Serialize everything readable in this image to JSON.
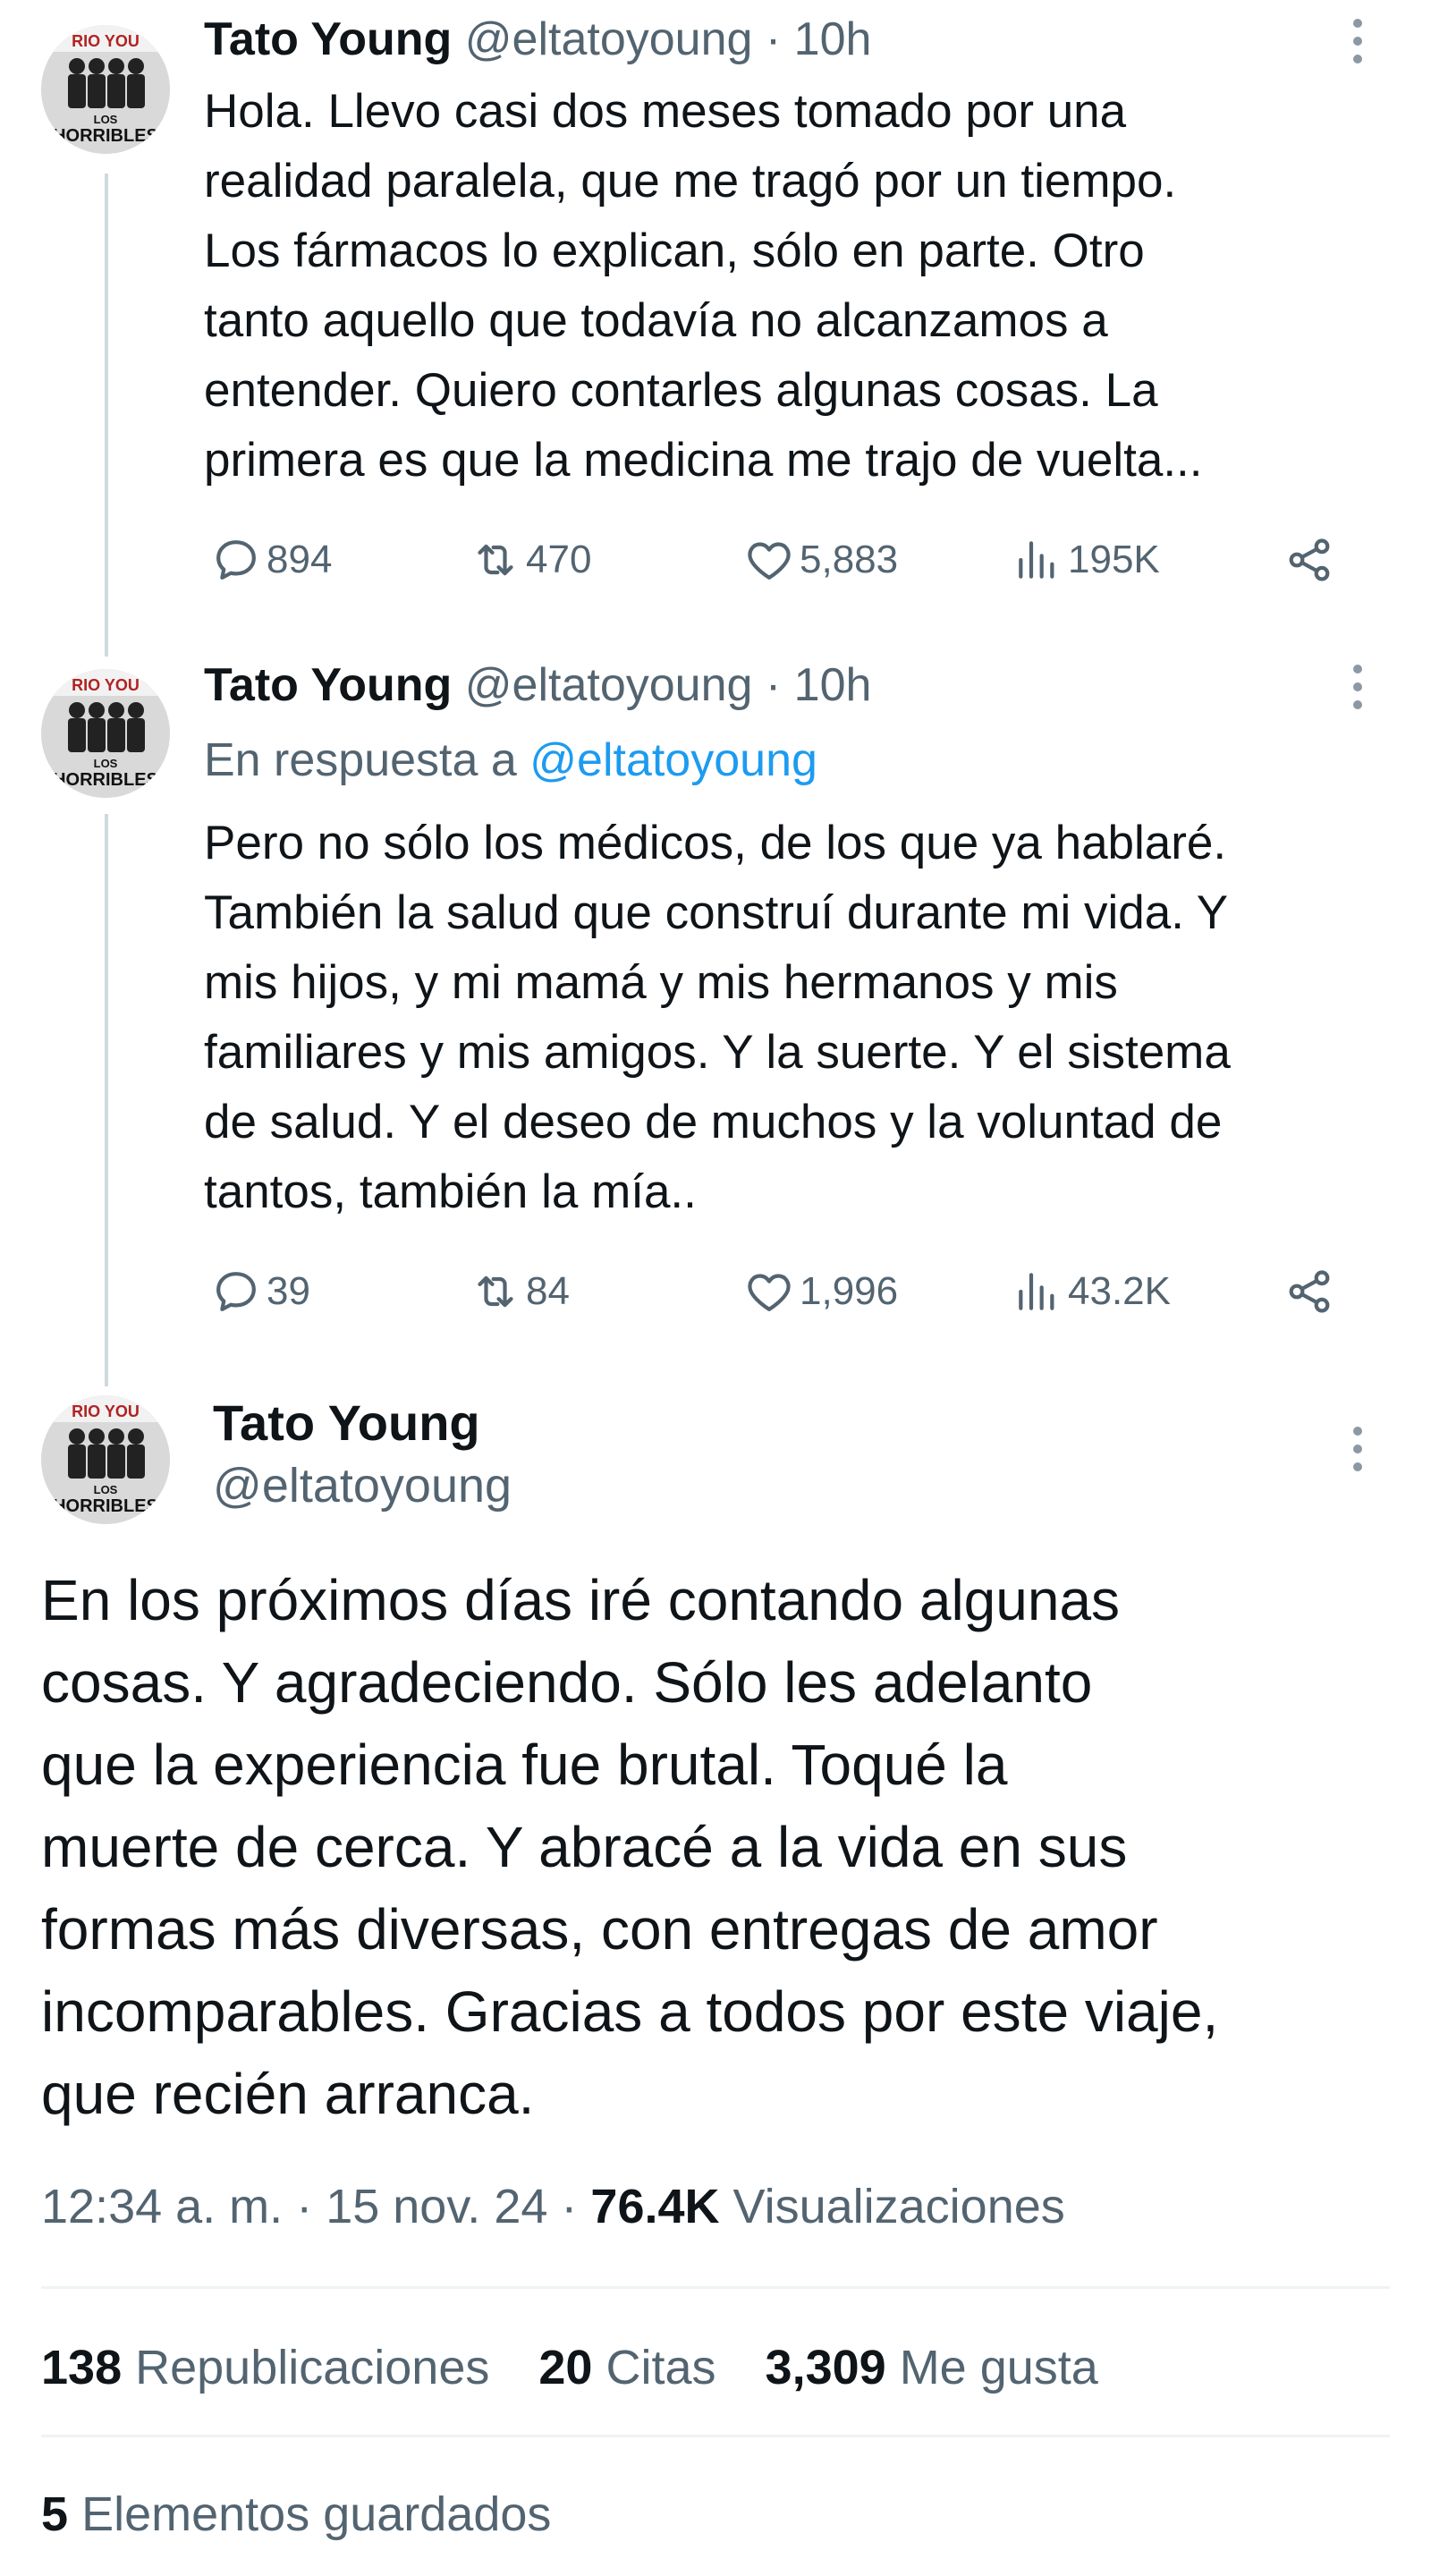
{
  "colors": {
    "text": "#0f1419",
    "secondary": "#536471",
    "link": "#1d9bf0",
    "thread_line": "#cfd9de"
  },
  "avatar": {
    "brand_text_top": "RIO YOU",
    "brand_text_small": "LOS",
    "brand_text_bottom": "HORRIBLES"
  },
  "tweets": [
    {
      "name": "Tato Young",
      "handle": "@eltatoyoung",
      "separator": " · ",
      "time": "10h",
      "text": "Hola. Llevo casi dos meses tomado por una\nrealidad paralela, que me tragó por un tiempo.\nLos fármacos lo explican, sólo en parte. Otro\ntanto aquello que todavía no alcanzamos a\nentender. Quiero contarles algunas cosas. La\nprimera es que la medicina me trajo de vuelta...",
      "replies": "894",
      "retweets": "470",
      "likes": "5,883",
      "views": "195K",
      "more_icon": "more-vertical-icon"
    },
    {
      "name": "Tato Young",
      "handle": "@eltatoyoung",
      "separator": " · ",
      "time": "10h",
      "reply_prefix": "En respuesta a ",
      "reply_handle": "@eltatoyoung",
      "text": "Pero no sólo los médicos, de los que ya hablaré.\nTambién la salud que construí durante mi vida. Y\nmis hijos, y mi mamá y mis hermanos y mis\nfamiliares y mis amigos. Y la suerte. Y el sistema\nde salud. Y el deseo de muchos y la voluntad de\ntantos, también la mía..",
      "replies": "39",
      "retweets": "84",
      "likes": "1,996",
      "views": "43.2K",
      "more_icon": "more-vertical-icon"
    }
  ],
  "main_tweet": {
    "name": "Tato Young",
    "handle": "@eltatoyoung",
    "text": "En los próximos días iré contando algunas\ncosas. Y agradeciendo. Sólo les adelanto\nque la experiencia fue brutal. Toqué la\nmuerte de cerca. Y abracé a la vida en sus\nformas más diversas, con entregas de amor\nincomparables. Gracias a todos por este viaje,\nque recién arranca.",
    "time": "12:34 a. m.",
    "date": "15 nov. 24",
    "views_count": "76.4K",
    "views_label": "Visualizaciones",
    "reposts_count": "138",
    "reposts_label": "Republicaciones",
    "quotes_count": "20",
    "quotes_label": "Citas",
    "likes_count": "3,309",
    "likes_label": "Me gusta",
    "bookmarks_count": "5",
    "bookmarks_label": "Elementos guardados"
  }
}
